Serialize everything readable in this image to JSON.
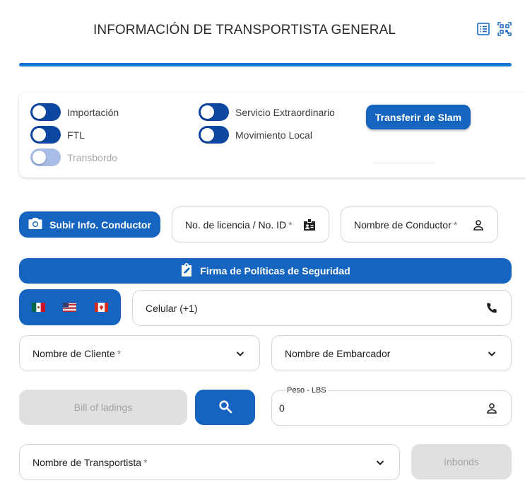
{
  "header": {
    "title": "INFORMACIÓN DE TRANSPORTISTA GENERAL",
    "list_icon": "list-icon",
    "qr_icon": "qr-scan-icon"
  },
  "toggles": {
    "importacion": "Importación",
    "ftl": "FTL",
    "transbordo": "Transbordo",
    "servicio_extraordinario": "Servicio Extraordinario",
    "movimiento_local": "Movimiento Local",
    "transfer_button": "Transferir de Slam"
  },
  "driver": {
    "upload_button": "Subir Info. Conductor",
    "license_field": "No. de licencia / No. ID",
    "name_field": "Nombre de Conductor",
    "required_mark": "*"
  },
  "policy_button": "Firma de Políticas de Seguridad",
  "phone": {
    "countries": [
      "mexico-flag",
      "usa-flag",
      "canada-flag"
    ],
    "field": "Celular (+1)"
  },
  "selects": {
    "cliente": "Nombre de Cliente",
    "embarcador": "Nombre de Embarcador",
    "transportista": "Nombre de Transportista"
  },
  "bill": {
    "button": "Bill of ladings",
    "search_icon": "search-icon"
  },
  "peso": {
    "label": "Peso - LBS",
    "value": "0"
  },
  "inbonds_button": "Inbonds",
  "colors": {
    "primary": "#1565c0",
    "accent_bar": "#1976d2",
    "toggle_on": "#0d47a1",
    "toggle_disabled": "#a7bde6",
    "disabled_button": "#e0e0e0"
  }
}
